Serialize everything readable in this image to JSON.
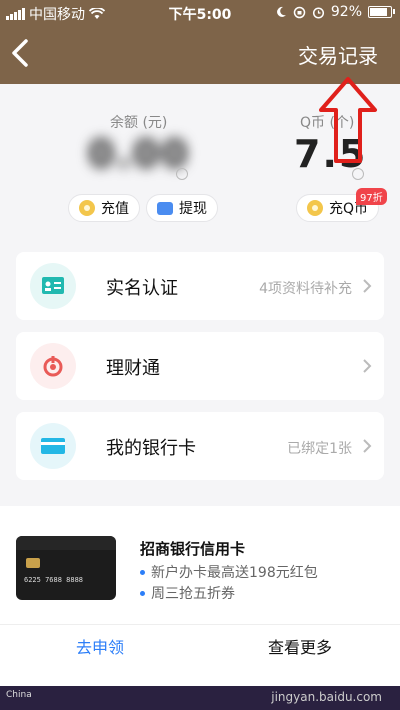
{
  "status_bar": {
    "carrier": "中国移动",
    "time": "下午5:00",
    "battery": "92%"
  },
  "nav": {
    "right_link": "交易记录"
  },
  "balance": {
    "label": "余额 (元)",
    "value": "0.00",
    "topup": "充值",
    "withdraw": "提现"
  },
  "qcoin": {
    "label": "Q币 (个)",
    "value": "7.5",
    "action": "充Q币",
    "badge": "97折"
  },
  "rows": [
    {
      "title": "实名认证",
      "meta": "4项资料待补充"
    },
    {
      "title": "理财通",
      "meta": ""
    },
    {
      "title": "我的银行卡",
      "meta": "已绑定1张"
    }
  ],
  "promo": {
    "title": "招商银行信用卡",
    "bullets": [
      "新户办卡最高送198元红包",
      "周三抢五折券"
    ],
    "apply": "去申领",
    "more": "查看更多"
  },
  "footer": {
    "watermark": "jingyan.baidu.com"
  },
  "colors": {
    "header": "#7e6449",
    "accent": "#2c7ef8",
    "annotation_arrow": "#e0201b"
  }
}
